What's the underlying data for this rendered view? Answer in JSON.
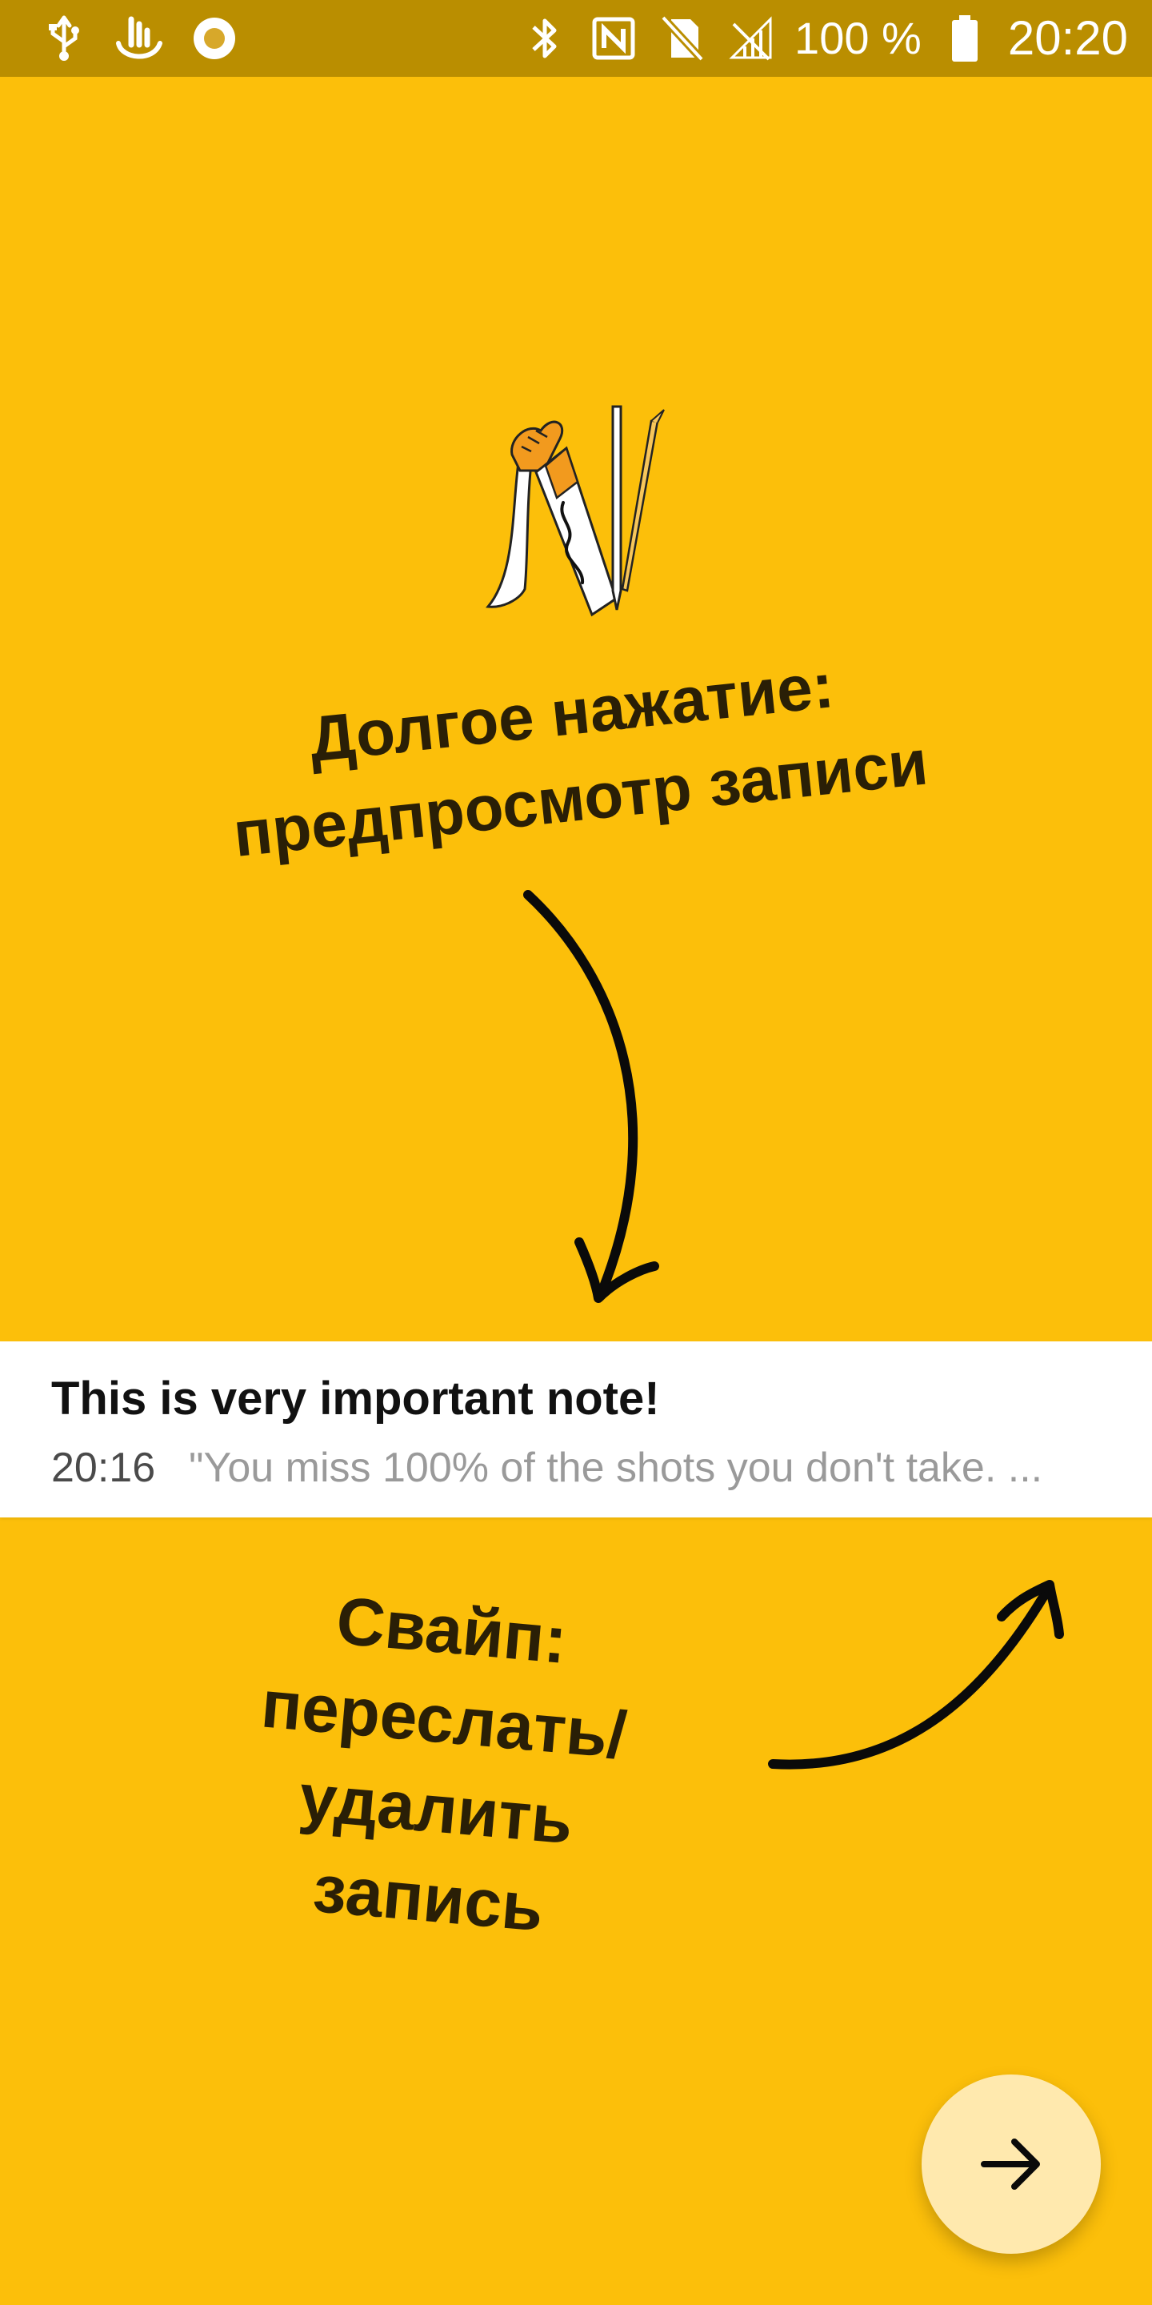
{
  "status_bar": {
    "left_icons": [
      "usb-icon",
      "touch-icon",
      "record-icon"
    ],
    "right_icons": [
      "bluetooth-icon",
      "nfc-icon",
      "no-sim-icon",
      "signal-off-icon",
      "battery-icon"
    ],
    "battery_text": "100 %",
    "time": "20:20"
  },
  "onboarding": {
    "hint_top": "Долгое нажатие: предпросмотр записи",
    "hint_bottom": "Свайп: переслать/ удалить запись"
  },
  "note": {
    "title": "This is very important note!",
    "time": "20:16",
    "preview": "\"You miss 100% of the shots you don't take. ..."
  },
  "fab": {
    "icon": "arrow-right-icon"
  },
  "colors": {
    "background": "#FCBF0A",
    "status_bar": "#BA8E00",
    "fab": "#FFE9AE",
    "card": "#FFFFFF"
  }
}
